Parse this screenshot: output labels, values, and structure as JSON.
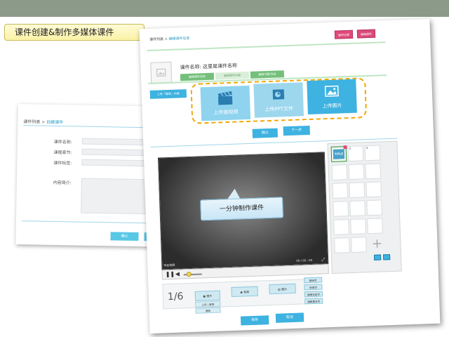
{
  "slide": {
    "title": "课件创建&制作多媒体课件",
    "note": "一分钟制作课件"
  },
  "back_form": {
    "crumb_list": "课件列表",
    "crumb_sep": ">",
    "crumb_current": "创建课件",
    "fields": [
      {
        "label": "课件名称:",
        "placeholder": "请输入名称"
      },
      {
        "label": "课程章节:",
        "placeholder": "请选章节"
      },
      {
        "label": "课件标签:",
        "placeholder": ""
      }
    ],
    "intro_label": "内容简介:",
    "confirm": "确认",
    "cancel": "取消"
  },
  "editor": {
    "crumb_list": "课件列表",
    "crumb_sep": ">",
    "crumb_current": "编辑课件信息",
    "course_title": "课件名称: 这里是课件名称",
    "top_buttons": [
      "操作记录",
      "编辑课件"
    ],
    "tabs": [
      "编辑课件信息",
      "编辑课件内容",
      "编辑习题/作业"
    ],
    "upload_type": "上传「媒体」内容",
    "tiles": [
      {
        "label": "上传做视频",
        "icon": "clapperboard-icon"
      },
      {
        "label": "上传PPT文件",
        "icon": "ppt-icon"
      },
      {
        "label": "上传图片",
        "icon": "image-icon"
      }
    ],
    "confirm": "确认",
    "next": "下一步",
    "video_caption": "作品视频",
    "video_time": "00 / 00 : 00",
    "thumb_label": "TITLE",
    "grid_numbers": [
      "1",
      "2",
      "3"
    ],
    "pager": "1/6",
    "tools": [
      {
        "label": "图片",
        "icon": "film-icon"
      },
      {
        "label": "音频",
        "icon": "audio-icon"
      },
      {
        "label": "图片",
        "icon": "picture-icon"
      }
    ],
    "tool_subs": [
      "上传 / 替换",
      "删除"
    ],
    "side_buttons": [
      "删除页",
      "新增页",
      "编辑当前页",
      "编辑更多页"
    ],
    "save": "保存",
    "cancel": "取消"
  }
}
